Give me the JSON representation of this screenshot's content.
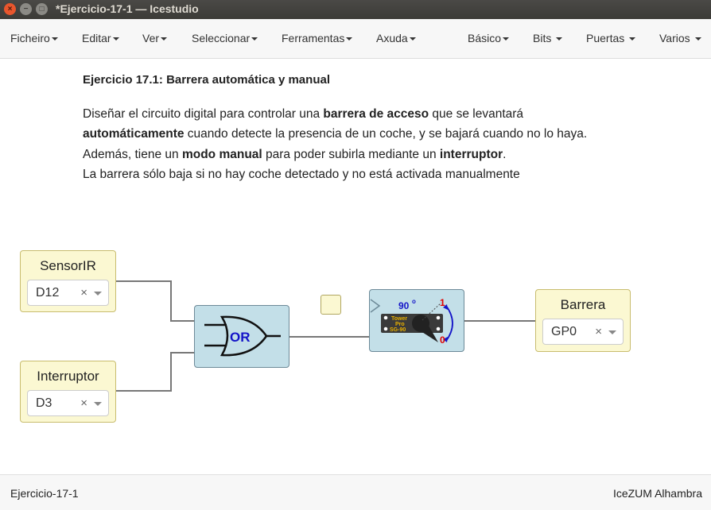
{
  "window": {
    "title": "*Ejercicio-17-1 — Icestudio",
    "close": "×",
    "min": "−",
    "max": "□"
  },
  "menu": {
    "left": [
      "Ficheiro",
      "Editar",
      "Ver",
      "Seleccionar",
      "Ferramentas",
      "Axuda"
    ],
    "right": [
      "Básico",
      "Bits",
      "Puertas",
      "Varios"
    ]
  },
  "doc": {
    "title_bold": "Ejercicio 17.1",
    "title_rest": ": Barrera automática y manual",
    "line1_a": "Diseñar el circuito digital para controlar una ",
    "line1_b": "barrera de acceso",
    "line1_c": " que se levantará",
    "line2_a": "automáticamente",
    "line2_b": " cuando detecte la presencia de un coche, y se bajará cuando no lo haya.",
    "line3_a": "Además, tiene un ",
    "line3_b": "modo manual",
    "line3_c": " para poder subirla mediante un ",
    "line3_d": "interruptor",
    "line3_e": ".",
    "line4": "La barrera sólo baja si no hay coche detectado y no está activada manualmente"
  },
  "blocks": {
    "sensor": {
      "label": "SensorIR",
      "pin": "D12",
      "clear": "×"
    },
    "switch": {
      "label": "Interruptor",
      "pin": "D3",
      "clear": "×"
    },
    "barrier": {
      "label": "Barrera",
      "pin": "GP0",
      "clear": "×"
    },
    "or_gate": {
      "label": "OR"
    },
    "servo": {
      "angle": "90",
      "degree": "o",
      "hi": "1",
      "lo": "0",
      "brand1": "Tower",
      "brand2": "Pro",
      "model": "SG-90"
    }
  },
  "status": {
    "left": "Ejercicio-17-1",
    "right": "IceZUM Alhambra"
  },
  "colors": {
    "block_yellow": "#fbf8d2",
    "block_blue": "#c3dfe8",
    "or_text": "#1414c8",
    "servo_red": "#e00000"
  }
}
